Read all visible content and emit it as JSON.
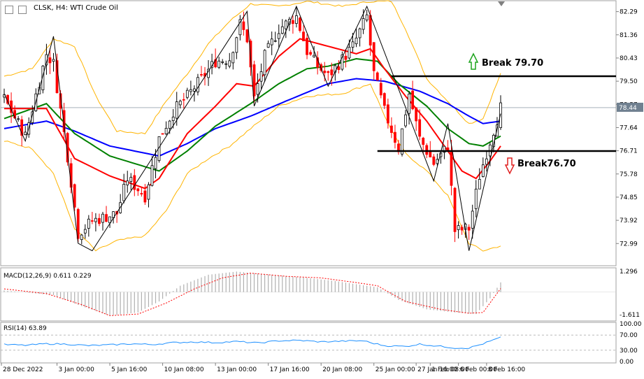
{
  "window": {
    "title": "CLSK, H4:  WTI Crude Oil"
  },
  "colors": {
    "candle_up": "#000000",
    "candle_down": "#ff0000",
    "ma_fast": "#ff0000",
    "ma_mid": "#008000",
    "ma_slow": "#0000ff",
    "bollinger": "#ffb400",
    "zigzag": "#000000",
    "macd_hist": "#b0b0b0",
    "macd_signal": "#ff0000",
    "rsi_line": "#1e90ff",
    "price_line": "#708090"
  },
  "chart_data": [
    {
      "type": "candlestick",
      "name": "price",
      "ylim": [
        72.1,
        82.7
      ],
      "y_ticks": [
        "82.29",
        "81.36",
        "80.43",
        "79.50",
        "78.57",
        "77.64",
        "76.71",
        "75.78",
        "74.85",
        "73.92",
        "72.99"
      ],
      "x_ticks": [
        "28 Dec 2022",
        "3 Jan 00:00",
        "5 Jan 16:00",
        "10 Jan 08:00",
        "13 Jan 00:00",
        "17 Jan 16:00",
        "20 Jan 08:00",
        "25 Jan 00:00",
        "27 Jan 16:00",
        "1 Feb 08:00",
        "6 Feb 00:00",
        "8 Feb 16:00"
      ],
      "last_price": "78.44",
      "last_price_value": 78.44,
      "hidden_tick": "78.57",
      "bars": 142,
      "zigzag_points": [
        [
          0,
          79.0
        ],
        [
          6,
          77.1
        ],
        [
          14,
          81.3
        ],
        [
          21,
          73.0
        ],
        [
          25,
          72.7
        ],
        [
          69,
          82.3
        ],
        [
          71,
          78.5
        ],
        [
          83,
          82.5
        ],
        [
          92,
          79.3
        ],
        [
          103,
          82.5
        ],
        [
          122,
          75.5
        ],
        [
          126,
          77.8
        ],
        [
          132,
          72.7
        ],
        [
          141,
          78.2
        ]
      ],
      "ohlc_anchors": [
        [
          0,
          78.8
        ],
        [
          6,
          77.3
        ],
        [
          12,
          80.6
        ],
        [
          14,
          80.2
        ],
        [
          18,
          76.5
        ],
        [
          21,
          73.4
        ],
        [
          25,
          73.9
        ],
        [
          32,
          74.2
        ],
        [
          35,
          75.6
        ],
        [
          40,
          74.9
        ],
        [
          44,
          77.2
        ],
        [
          48,
          78.3
        ],
        [
          52,
          78.9
        ],
        [
          56,
          79.6
        ],
        [
          60,
          80.3
        ],
        [
          64,
          80.4
        ],
        [
          67,
          81.8
        ],
        [
          69,
          81.2
        ],
        [
          71,
          78.8
        ],
        [
          74,
          80.5
        ],
        [
          78,
          81.6
        ],
        [
          83,
          82.1
        ],
        [
          86,
          80.7
        ],
        [
          89,
          80.1
        ],
        [
          92,
          79.7
        ],
        [
          95,
          80.2
        ],
        [
          99,
          80.9
        ],
        [
          103,
          82.1
        ],
        [
          105,
          79.8
        ],
        [
          108,
          78.3
        ],
        [
          112,
          76.8
        ],
        [
          115,
          79.0
        ],
        [
          118,
          77.2
        ],
        [
          122,
          76.2
        ],
        [
          126,
          76.9
        ],
        [
          128,
          73.5
        ],
        [
          132,
          73.6
        ],
        [
          135,
          75.7
        ],
        [
          138,
          77.1
        ],
        [
          141,
          78.44
        ]
      ],
      "ma_fast_anchors": [
        [
          0,
          78.4
        ],
        [
          12,
          78.4
        ],
        [
          20,
          76.4
        ],
        [
          30,
          75.7
        ],
        [
          40,
          75.2
        ],
        [
          44,
          75.6
        ],
        [
          52,
          77.4
        ],
        [
          60,
          78.5
        ],
        [
          66,
          79.4
        ],
        [
          71,
          79.3
        ],
        [
          78,
          80.5
        ],
        [
          84,
          81.2
        ],
        [
          92,
          80.9
        ],
        [
          100,
          80.6
        ],
        [
          104,
          80.8
        ],
        [
          108,
          80.0
        ],
        [
          114,
          78.9
        ],
        [
          120,
          77.9
        ],
        [
          126,
          76.7
        ],
        [
          130,
          75.9
        ],
        [
          134,
          75.6
        ],
        [
          138,
          76.3
        ],
        [
          141,
          76.9
        ]
      ],
      "ma_mid_anchors": [
        [
          0,
          78.0
        ],
        [
          12,
          78.6
        ],
        [
          20,
          77.4
        ],
        [
          30,
          76.5
        ],
        [
          44,
          75.9
        ],
        [
          52,
          76.7
        ],
        [
          60,
          77.7
        ],
        [
          70,
          78.6
        ],
        [
          78,
          79.4
        ],
        [
          86,
          80.0
        ],
        [
          92,
          80.1
        ],
        [
          100,
          80.4
        ],
        [
          106,
          80.3
        ],
        [
          112,
          79.4
        ],
        [
          120,
          78.5
        ],
        [
          126,
          77.6
        ],
        [
          132,
          77.0
        ],
        [
          136,
          76.9
        ],
        [
          141,
          77.3
        ]
      ],
      "ma_slow_anchors": [
        [
          0,
          77.6
        ],
        [
          12,
          77.9
        ],
        [
          20,
          77.5
        ],
        [
          30,
          76.9
        ],
        [
          44,
          76.5
        ],
        [
          52,
          77.0
        ],
        [
          60,
          77.6
        ],
        [
          70,
          78.1
        ],
        [
          80,
          78.7
        ],
        [
          92,
          79.4
        ],
        [
          100,
          79.6
        ],
        [
          108,
          79.5
        ],
        [
          118,
          79.1
        ],
        [
          126,
          78.6
        ],
        [
          132,
          78.1
        ],
        [
          136,
          77.8
        ],
        [
          141,
          77.9
        ]
      ],
      "bb_upper_anchors": [
        [
          0,
          79.7
        ],
        [
          8,
          80.0
        ],
        [
          14,
          81.2
        ],
        [
          20,
          80.9
        ],
        [
          26,
          78.9
        ],
        [
          32,
          77.5
        ],
        [
          40,
          77.4
        ],
        [
          46,
          78.7
        ],
        [
          52,
          79.8
        ],
        [
          58,
          81.0
        ],
        [
          64,
          81.9
        ],
        [
          70,
          82.6
        ],
        [
          78,
          82.5
        ],
        [
          86,
          82.7
        ],
        [
          96,
          82.5
        ],
        [
          104,
          82.7
        ],
        [
          110,
          82.7
        ],
        [
          114,
          81.6
        ],
        [
          120,
          79.6
        ],
        [
          126,
          78.7
        ],
        [
          132,
          77.8
        ],
        [
          136,
          78.0
        ],
        [
          141,
          79.8
        ]
      ],
      "bb_lower_anchors": [
        [
          0,
          77.1
        ],
        [
          8,
          76.8
        ],
        [
          14,
          75.8
        ],
        [
          20,
          73.6
        ],
        [
          26,
          72.7
        ],
        [
          32,
          73.1
        ],
        [
          40,
          73.3
        ],
        [
          46,
          74.3
        ],
        [
          52,
          75.8
        ],
        [
          58,
          76.4
        ],
        [
          64,
          76.9
        ],
        [
          70,
          77.6
        ],
        [
          78,
          78.5
        ],
        [
          86,
          78.9
        ],
        [
          96,
          79.0
        ],
        [
          104,
          79.4
        ],
        [
          110,
          77.5
        ],
        [
          114,
          76.6
        ],
        [
          120,
          75.9
        ],
        [
          126,
          74.9
        ],
        [
          132,
          73.0
        ],
        [
          136,
          72.7
        ],
        [
          141,
          72.9
        ]
      ],
      "annotations": [
        {
          "label": "Break 79.70",
          "value": 79.7,
          "direction": "up",
          "from_bar": 110
        },
        {
          "label": "Break76.70",
          "value": 76.7,
          "direction": "down",
          "from_bar": 106
        }
      ]
    },
    {
      "type": "histogram",
      "name": "MACD",
      "title": "MACD(12,26,9) 0.611 0.229",
      "y_ticks": [
        "1.296",
        "-1.611"
      ],
      "ylim": [
        -1.75,
        1.45
      ],
      "hist_anchors": [
        [
          0,
          0.1
        ],
        [
          14,
          -0.2
        ],
        [
          22,
          -0.9
        ],
        [
          30,
          -1.5
        ],
        [
          38,
          -1.3
        ],
        [
          44,
          -0.6
        ],
        [
          50,
          0.4
        ],
        [
          58,
          1.1
        ],
        [
          66,
          1.3
        ],
        [
          76,
          1.1
        ],
        [
          86,
          0.9
        ],
        [
          94,
          0.7
        ],
        [
          100,
          0.5
        ],
        [
          106,
          0.3
        ],
        [
          112,
          -0.5
        ],
        [
          120,
          -1.1
        ],
        [
          128,
          -1.3
        ],
        [
          134,
          -1.4
        ],
        [
          138,
          -0.4
        ],
        [
          141,
          0.611
        ]
      ],
      "signal_anchors": [
        [
          0,
          0.2
        ],
        [
          12,
          -0.1
        ],
        [
          22,
          -0.8
        ],
        [
          30,
          -1.5
        ],
        [
          38,
          -1.4
        ],
        [
          46,
          -0.7
        ],
        [
          54,
          0.2
        ],
        [
          62,
          0.9
        ],
        [
          70,
          1.2
        ],
        [
          80,
          1.0
        ],
        [
          90,
          0.9
        ],
        [
          100,
          0.6
        ],
        [
          106,
          0.4
        ],
        [
          114,
          -0.6
        ],
        [
          124,
          -1.1
        ],
        [
          132,
          -1.35
        ],
        [
          136,
          -1.3
        ],
        [
          141,
          0.229
        ]
      ]
    },
    {
      "type": "line",
      "name": "RSI",
      "title": "RSI(14) 63.89",
      "y_ticks": [
        "100.00",
        "70.00",
        "30.00",
        "0.00"
      ],
      "ylim": [
        0,
        100
      ],
      "levels": [
        70,
        30
      ],
      "rsi_anchors": [
        [
          0,
          45
        ],
        [
          6,
          43
        ],
        [
          12,
          47
        ],
        [
          18,
          46
        ],
        [
          24,
          42
        ],
        [
          30,
          44
        ],
        [
          36,
          47
        ],
        [
          42,
          45
        ],
        [
          48,
          50
        ],
        [
          54,
          52
        ],
        [
          60,
          50
        ],
        [
          66,
          53
        ],
        [
          72,
          49
        ],
        [
          78,
          55
        ],
        [
          84,
          56
        ],
        [
          90,
          52
        ],
        [
          96,
          54
        ],
        [
          102,
          55
        ],
        [
          104,
          50
        ],
        [
          108,
          42
        ],
        [
          114,
          40
        ],
        [
          118,
          46
        ],
        [
          124,
          40
        ],
        [
          128,
          36
        ],
        [
          132,
          36
        ],
        [
          136,
          47
        ],
        [
          141,
          63.89
        ]
      ]
    }
  ]
}
